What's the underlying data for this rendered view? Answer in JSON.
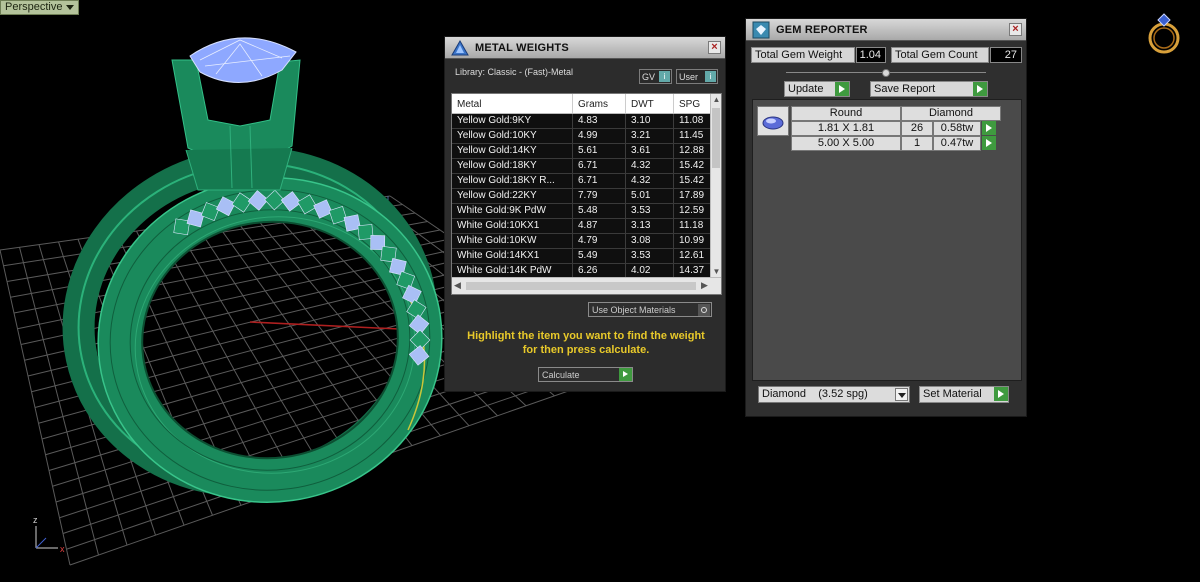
{
  "viewport": {
    "label": "Perspective",
    "axes": {
      "z": "z",
      "x": "x"
    }
  },
  "metal_weights": {
    "title": "METAL WEIGHTS",
    "library_label": "Library: Classic - (Fast)-Metal",
    "gv_label": "GV",
    "user_label": "User",
    "columns": [
      "Metal",
      "Grams",
      "DWT",
      "SPG"
    ],
    "rows": [
      {
        "metal": "Yellow Gold:9KY",
        "grams": "4.83",
        "dwt": "3.10",
        "spg": "11.08"
      },
      {
        "metal": "Yellow Gold:10KY",
        "grams": "4.99",
        "dwt": "3.21",
        "spg": "11.45"
      },
      {
        "metal": "Yellow Gold:14KY",
        "grams": "5.61",
        "dwt": "3.61",
        "spg": "12.88"
      },
      {
        "metal": "Yellow Gold:18KY",
        "grams": "6.71",
        "dwt": "4.32",
        "spg": "15.42"
      },
      {
        "metal": "Yellow Gold:18KY R...",
        "grams": "6.71",
        "dwt": "4.32",
        "spg": "15.42"
      },
      {
        "metal": "Yellow Gold:22KY",
        "grams": "7.79",
        "dwt": "5.01",
        "spg": "17.89"
      },
      {
        "metal": "White Gold:9K PdW",
        "grams": "5.48",
        "dwt": "3.53",
        "spg": "12.59"
      },
      {
        "metal": "White Gold:10KX1",
        "grams": "4.87",
        "dwt": "3.13",
        "spg": "11.18"
      },
      {
        "metal": "White Gold:10KW",
        "grams": "4.79",
        "dwt": "3.08",
        "spg": "10.99"
      },
      {
        "metal": "White Gold:14KX1",
        "grams": "5.49",
        "dwt": "3.53",
        "spg": "12.61"
      },
      {
        "metal": "White Gold:14K PdW",
        "grams": "6.26",
        "dwt": "4.02",
        "spg": "14.37"
      }
    ],
    "object_materials_label": "Use Object Materials",
    "hint_line1": "Highlight the item you want to find the weight",
    "hint_line2": "for then press calculate.",
    "calculate_label": "Calculate"
  },
  "gem_reporter": {
    "title": "GEM REPORTER",
    "total_weight_label": "Total Gem Weight",
    "total_weight_value": "1.04",
    "total_count_label": "Total Gem Count",
    "total_count_value": "27",
    "update_label": "Update",
    "save_report_label": "Save Report",
    "headers": [
      "Round",
      "Diamond"
    ],
    "rows": [
      {
        "size": "1.81 X 1.81",
        "count": "26",
        "weight": "0.58tw"
      },
      {
        "size": "5.00 X 5.00",
        "count": "1",
        "weight": "0.47tw"
      }
    ],
    "material_select": "Diamond    (3.52 spg)",
    "set_material_label": "Set Material"
  },
  "colors": {
    "ring_green": "#1f8a5a",
    "gem_blue": "#9fb4ff",
    "hint_yellow": "#e8c92a",
    "play_green": "#3f9a3f"
  }
}
